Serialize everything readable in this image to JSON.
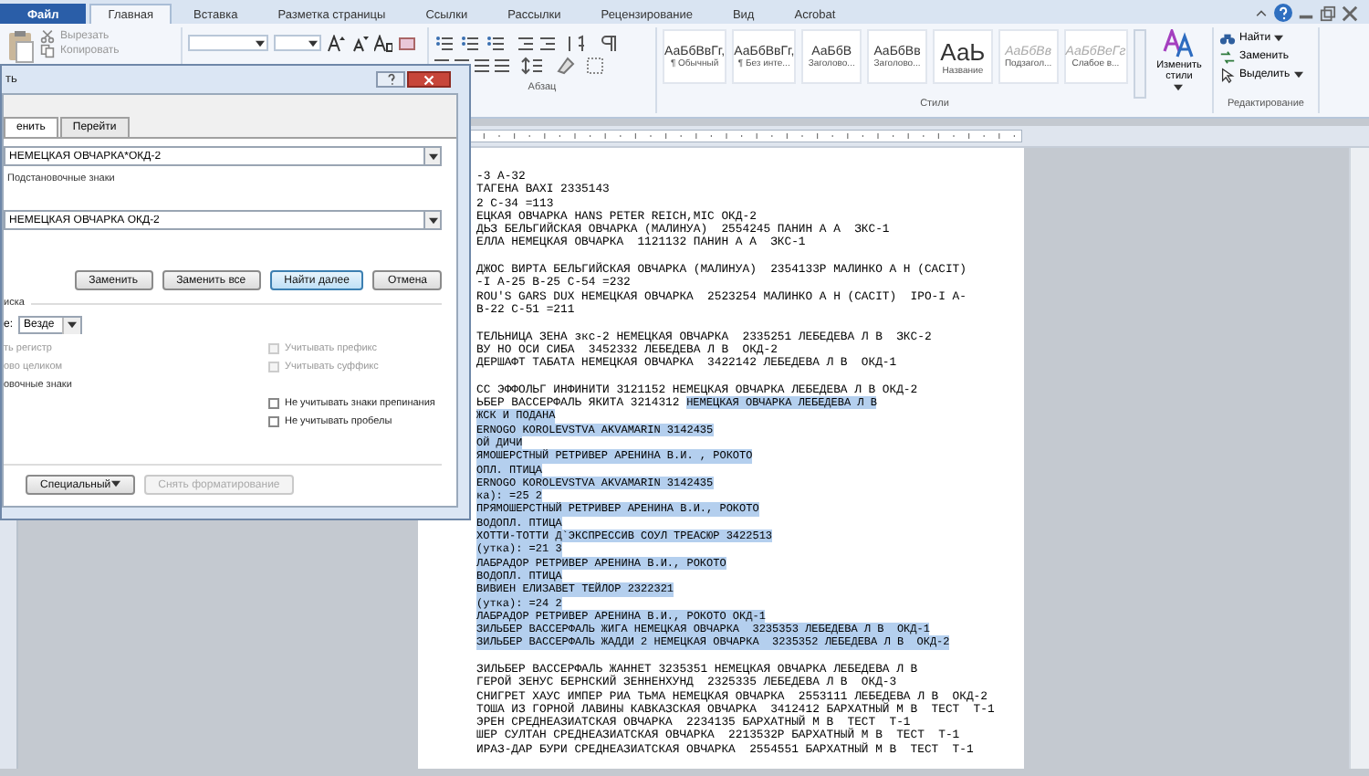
{
  "ribbon_tabs": [
    {
      "label": "Файл",
      "kind": "file",
      "selected": false
    },
    {
      "label": "Главная",
      "kind": "tab",
      "selected": true
    },
    {
      "label": "Вставка",
      "kind": "tab",
      "selected": false
    },
    {
      "label": "Разметка страницы",
      "kind": "tab",
      "selected": false
    },
    {
      "label": "Ссылки",
      "kind": "tab",
      "selected": false
    },
    {
      "label": "Рассылки",
      "kind": "tab",
      "selected": false
    },
    {
      "label": "Рецензирование",
      "kind": "tab",
      "selected": false
    },
    {
      "label": "Вид",
      "kind": "tab",
      "selected": false
    },
    {
      "label": "Acrobat",
      "kind": "tab",
      "selected": false
    }
  ],
  "ribbon": {
    "clipboard": [
      {
        "label": "Вырезать",
        "disabled": true
      },
      {
        "label": "Копировать",
        "disabled": true
      }
    ],
    "paragraph_group": "Абзац",
    "styles": [
      {
        "sample": "АаБбВвГг,",
        "name": "¶ Обычный"
      },
      {
        "sample": "АаБбВвГг,",
        "name": "¶ Без инте..."
      },
      {
        "sample": "АаБбВ",
        "name": "Заголово..."
      },
      {
        "sample": "АаБбВв",
        "name": "Заголово..."
      },
      {
        "sample": "АаЬ",
        "name": "Название"
      },
      {
        "sample": "АаБбВв",
        "name": "Подзагол..."
      },
      {
        "sample": "АаБбВеГг",
        "name": "Слабое в..."
      }
    ],
    "change_styles": "Изменить стили",
    "styles_group": "Стили",
    "editing": [
      {
        "label": "Найти",
        "dropdown": true
      },
      {
        "label": "Заменить",
        "dropdown": false
      },
      {
        "label": "Выделить",
        "dropdown": true
      }
    ],
    "editing_group": "Редактирование"
  },
  "dialog": {
    "title": "ть",
    "tabs": [
      {
        "label": "енить",
        "selected": true
      },
      {
        "label": "Перейти",
        "selected": false
      }
    ],
    "find_value": "НЕМЕЦКАЯ ОВЧАРКА*ОКД-2",
    "find_note": "Подстановочные знаки",
    "replace_value": "НЕМЕЦКАЯ ОВЧАРКА ОКД-2",
    "buttons": [
      {
        "label": "Заменить",
        "default": false
      },
      {
        "label": "Заменить все",
        "default": false
      },
      {
        "label": "Найти далее",
        "default": true
      },
      {
        "label": "Отмена",
        "default": false
      }
    ],
    "options_heading": "иска",
    "scope_label": "е:",
    "scope_value": "Везде",
    "left_options": [
      {
        "label": "ть регистр",
        "disabled": true
      },
      {
        "label": "ово целиком",
        "disabled": true
      },
      {
        "label": "овочные знаки",
        "disabled": false
      }
    ],
    "right_options": [
      {
        "label": "Учитывать префикс",
        "checked": false,
        "disabled": true
      },
      {
        "label": "Учитывать суффикс",
        "checked": false,
        "disabled": true
      },
      {
        "label": "Не учитывать знаки препинания",
        "checked": false,
        "disabled": false
      },
      {
        "label": "Не учитывать пробелы",
        "checked": false,
        "disabled": false
      }
    ],
    "bottom_buttons": [
      {
        "label": "Специальный",
        "dropdown": true,
        "disabled": false
      },
      {
        "label": "Снять форматирование",
        "dropdown": false,
        "disabled": true
      }
    ]
  },
  "document": {
    "lines": [
      {
        "kind": "text",
        "segments": [
          {
            "text": "-3 А-32",
            "selected": false
          }
        ]
      },
      {
        "kind": "text",
        "segments": [
          {
            "text": "ТАГЕНА BAXI 2335143",
            "selected": false
          }
        ]
      },
      {
        "kind": "text",
        "segments": [
          {
            "text": "2 С-34 =113",
            "selected": false
          }
        ]
      },
      {
        "kind": "text",
        "segments": [
          {
            "text": "ЕЦКАЯ ОВЧАРКА HANS PETER REICH,MIC ОКД-2",
            "selected": false
          }
        ]
      },
      {
        "kind": "text",
        "segments": [
          {
            "text": "ДЬЗ БЕЛЬГИЙСКАЯ ОВЧАРКА (МАЛИНУА)  2554245 ПАНИН А А  ЗКС-1",
            "selected": false
          }
        ]
      },
      {
        "kind": "text",
        "segments": [
          {
            "text": "ЕЛЛА НЕМЕЦКАЯ ОВЧАРКА  1121132 ПАНИН А А  ЗКС-1",
            "selected": false
          }
        ]
      },
      {
        "kind": "blank"
      },
      {
        "kind": "text",
        "segments": [
          {
            "text": "ДЖОС ВИРТА БЕЛЬГИЙСКАЯ ОВЧАРКА (МАЛИНУА)  2354133Р МАЛИНКО А Н (CACIT)",
            "selected": false
          }
        ]
      },
      {
        "kind": "text",
        "segments": [
          {
            "text": "-I А-25 В-25 С-54 =232",
            "selected": false
          }
        ]
      },
      {
        "kind": "text",
        "segments": [
          {
            "text": "ROU'S GARS DUX НЕМЕЦКАЯ ОВЧАРКА  2523254 МАЛИНКО А Н (CACIT)  IPO-I А-",
            "selected": false
          }
        ]
      },
      {
        "kind": "text",
        "segments": [
          {
            "text": "В-22 С-51 =211",
            "selected": false
          }
        ]
      },
      {
        "kind": "blank"
      },
      {
        "kind": "text",
        "segments": [
          {
            "text": "ТЕЛЬНИЦА ЗЕНА зкс-2 НЕМЕЦКАЯ ОВЧАРКА  2335251 ЛЕБЕДЕВА Л В  ЗКС-2",
            "selected": false
          }
        ]
      },
      {
        "kind": "text",
        "segments": [
          {
            "text": "ВУ НО ОСИ СИБА  3452332 ЛЕБЕДЕВА Л В  ОКД-2",
            "selected": false
          }
        ]
      },
      {
        "kind": "text",
        "segments": [
          {
            "text": "ДЕРШАФТ ТАБАТА НЕМЕЦКАЯ ОВЧАРКА  3422142 ЛЕБЕДЕВА Л В  ОКД-1",
            "selected": false
          }
        ]
      },
      {
        "kind": "blank"
      },
      {
        "kind": "text",
        "segments": [
          {
            "text": "СС ЭФФОЛЬГ ИНФИНИТИ 3121152 НЕМЕЦКАЯ ОВЧАРКА ЛЕБЕДЕВА Л В ОКД-2",
            "selected": false
          }
        ]
      },
      {
        "kind": "text",
        "segments": [
          {
            "text": "ЬБЕР ВАССЕРФАЛЬ ЯКИТА 3214312 ",
            "selected": false
          },
          {
            "text": "НЕМЕЦКАЯ ОВЧАРКА ЛЕБЕДЕВА Л В",
            "selected": true
          }
        ]
      },
      {
        "kind": "text",
        "segments": [
          {
            "text": "ЖСК И ПОДАНА",
            "selected": true
          }
        ]
      },
      {
        "kind": "text",
        "segments": [
          {
            "text": "ERNOGO KOROLEVSTVA AKVAMARIN 3142435",
            "selected": true
          }
        ]
      },
      {
        "kind": "text",
        "segments": [
          {
            "text": "ОЙ ДИЧИ",
            "selected": true
          }
        ]
      },
      {
        "kind": "text",
        "segments": [
          {
            "text": "ЯМОШЕРСТНЫЙ РЕТРИВЕР АРЕНИНА В.И. , РОКОТО",
            "selected": true
          }
        ]
      },
      {
        "kind": "text",
        "segments": [
          {
            "text": "ОПЛ. ПТИЦА",
            "selected": true
          }
        ]
      },
      {
        "kind": "text",
        "segments": [
          {
            "text": "ERNOGO KOROLEVSTVA AKVAMARIN 3142435",
            "selected": true
          }
        ]
      },
      {
        "kind": "text",
        "segments": [
          {
            "text": "ка): =25 2",
            "selected": true
          }
        ]
      },
      {
        "kind": "text",
        "segments": [
          {
            "text": "ПРЯМОШЕРСТНЫЙ РЕТРИВЕР АРЕНИНА В.И., РОКОТО",
            "selected": true
          }
        ]
      },
      {
        "kind": "text",
        "segments": [
          {
            "text": "ВОДОПЛ. ПТИЦА",
            "selected": true
          }
        ]
      },
      {
        "kind": "text",
        "segments": [
          {
            "text": "ХОТТИ-ТОТТИ Д`ЭКСПРЕССИВ СОУЛ ТРЕАСЮР 3422513",
            "selected": true
          }
        ]
      },
      {
        "kind": "text",
        "segments": [
          {
            "text": "(утка): =21 3",
            "selected": true
          }
        ]
      },
      {
        "kind": "text",
        "segments": [
          {
            "text": "ЛАБРАДОР РЕТРИВЕР АРЕНИНА В.И., РОКОТО",
            "selected": true
          }
        ]
      },
      {
        "kind": "text",
        "segments": [
          {
            "text": "ВОДОПЛ. ПТИЦА",
            "selected": true
          }
        ]
      },
      {
        "kind": "text",
        "segments": [
          {
            "text": "ВИВИЕН ЕЛИЗАВЕТ ТЕЙЛОР 2322321",
            "selected": true
          }
        ]
      },
      {
        "kind": "text",
        "segments": [
          {
            "text": "(утка): =24 2",
            "selected": true
          }
        ]
      },
      {
        "kind": "text",
        "segments": [
          {
            "text": "ЛАБРАДОР РЕТРИВЕР АРЕНИНА В.И., РОКОТО ОКД-1",
            "selected": true
          }
        ]
      },
      {
        "kind": "text",
        "segments": [
          {
            "text": "ЗИЛЬБЕР ВАССЕРФАЛЬ ЖИГА НЕМЕЦКАЯ ОВЧАРКА  3235353 ЛЕБЕДЕВА Л В  ОКД-1",
            "selected": true
          }
        ]
      },
      {
        "kind": "text",
        "segments": [
          {
            "text": "ЗИЛЬБЕР ВАССЕРФАЛЬ ЖАДДИ 2 НЕМЕЦКАЯ ОВЧАРКА  3235352 ЛЕБЕДЕВА Л В  ОКД-2",
            "selected": true
          }
        ]
      },
      {
        "kind": "blank"
      },
      {
        "kind": "text",
        "segments": [
          {
            "text": "ЗИЛЬБЕР ВАССЕРФАЛЬ ЖАННЕТ 3235351 НЕМЕЦКАЯ ОВЧАРКА ЛЕБЕДЕВА Л В",
            "selected": false
          }
        ]
      },
      {
        "kind": "text",
        "segments": [
          {
            "text": "ГЕРОЙ ЗЕНУС БЕРНСКИЙ ЗЕННЕНХУНД  2325335 ЛЕБЕДЕВА Л В  ОКД-3",
            "selected": false
          }
        ]
      },
      {
        "kind": "text",
        "segments": [
          {
            "text": "СНИГРЕТ ХАУС ИМПЕР РИА ТЬМА НЕМЕЦКАЯ ОВЧАРКА  2553111 ЛЕБЕДЕВА Л В  ОКД-2",
            "selected": false
          }
        ]
      },
      {
        "kind": "text",
        "segments": [
          {
            "text": "ТОША ИЗ ГОРНОЙ ЛАВИНЫ КАВКАЗСКАЯ ОВЧАРКА  3412412 БАРХАТНЫЙ М В  ТЕСТ  Т-1",
            "selected": false
          }
        ]
      },
      {
        "kind": "text",
        "segments": [
          {
            "text": "ЭРЕН СРЕДНЕАЗИАТСКАЯ ОВЧАРКА  2234135 БАРХАТНЫЙ М В  ТЕСТ  Т-1",
            "selected": false
          }
        ]
      },
      {
        "kind": "text",
        "segments": [
          {
            "text": "ШЕР СУЛТАН СРЕДНЕАЗИАТСКАЯ ОВЧАРКА  2213532Р БАРХАТНЫЙ М В  ТЕСТ  Т-1",
            "selected": false
          }
        ]
      },
      {
        "kind": "text",
        "segments": [
          {
            "text": "ИРАЗ-ДАР БУРИ СРЕДНЕАЗИАТСКАЯ ОВЧАРКА  2554551 БАРХАТНЫЙ М В  ТЕСТ  Т-1",
            "selected": false
          }
        ]
      }
    ]
  }
}
